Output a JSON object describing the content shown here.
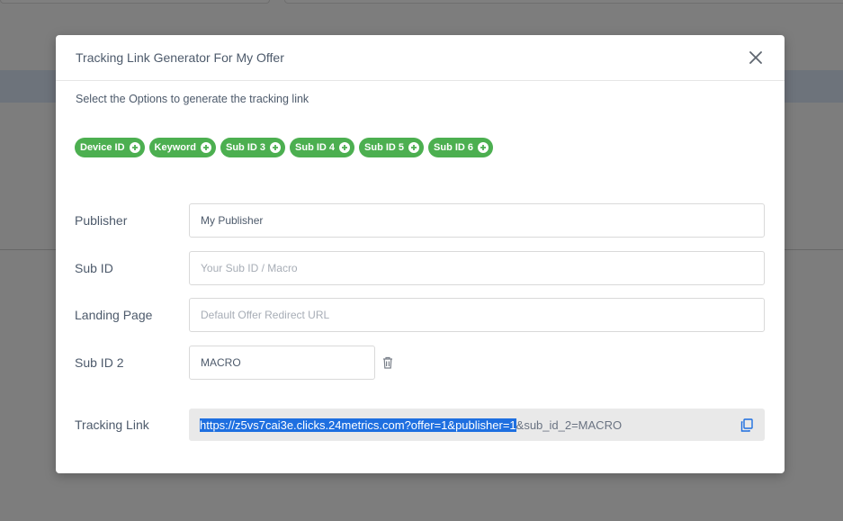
{
  "modal": {
    "title": "Tracking Link Generator For My Offer",
    "subtitle": "Select the Options to generate the tracking link"
  },
  "chips": [
    {
      "label": "Device ID"
    },
    {
      "label": "Keyword"
    },
    {
      "label": "Sub ID 3"
    },
    {
      "label": "Sub ID 4"
    },
    {
      "label": "Sub ID 5"
    },
    {
      "label": "Sub ID 6"
    }
  ],
  "form": {
    "publisher": {
      "label": "Publisher",
      "value": "My Publisher",
      "placeholder": ""
    },
    "sub_id": {
      "label": "Sub ID",
      "value": "",
      "placeholder": "Your Sub ID / Macro"
    },
    "landing_page": {
      "label": "Landing Page",
      "value": "",
      "placeholder": "Default Offer Redirect URL"
    },
    "sub_id_2": {
      "label": "Sub ID 2",
      "value": "MACRO",
      "placeholder": ""
    },
    "tracking_link": {
      "label": "Tracking Link",
      "selected_part": "https://z5vs7cai3e.clicks.24metrics.com?offer=1&publisher=1",
      "rest_part": "&sub_id_2=MACRO"
    }
  },
  "colors": {
    "chip_green": "#4caf50",
    "selection_blue": "#1e6fe0",
    "text": "#4d5a6b"
  },
  "icons": {
    "close": "close-icon",
    "chip_add": "plus-circle-icon",
    "delete": "trash-icon",
    "copy": "copy-icon"
  }
}
